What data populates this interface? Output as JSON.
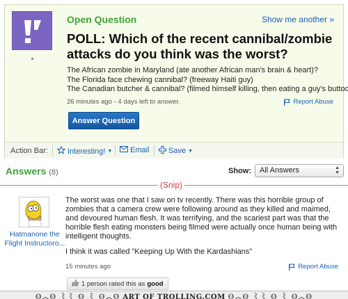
{
  "question": {
    "type_label": "Open Question",
    "show_more": "Show me another »",
    "title": "POLL: Which of the recent cannibal/zombie attacks do you think was the worst?",
    "body_lines": [
      "The African zombie in Maryland (ate another African man's brain & heart)?",
      "The Florida face chewing cannibal? (freeway Haiti guy)",
      "The Canadian butcher & cannibal? (filmed himself killing, then eating a guy's buttock)"
    ],
    "meta": "26 minutes ago - 4 days left to answer.",
    "report_label": "Report Abuse",
    "answer_button": "Answer Question",
    "icon": "question-mark-icon"
  },
  "action_bar": {
    "label": "Action Bar:",
    "interesting": "Interesting!",
    "email": "Email",
    "save": "Save"
  },
  "answers": {
    "heading": "Answers",
    "count": "(8)",
    "show_label": "Show:",
    "sort_value": "All Answers"
  },
  "snip_label": "(Snip)",
  "answer": {
    "user": "Hatmanone the Flight Instructoro...",
    "text": "The worst was one that I saw on tv recently. There was this horrible group of zombies that a camera crew were following around as they killed and maimed, and devoured human flesh. It was terrifying, and the scariest part was that the horrible flesh eating monsters being filmed were actually once human being with intelligent thoughts.",
    "quote": "I think it was called \"Keeping Up With the Kardashians\"",
    "time": "15 minutes ago",
    "report_label": "Report Abuse",
    "rated_prefix": "1 person rated this as",
    "rated_value": "good"
  },
  "footer": {
    "watermark": "ART OF TROLLING.COM"
  },
  "colors": {
    "accent_green": "#3ea33a",
    "link_blue": "#1a5fb4",
    "button_blue": "#14589f",
    "snip_red": "#d63c3c",
    "question_bg": "#f7fbe9"
  }
}
